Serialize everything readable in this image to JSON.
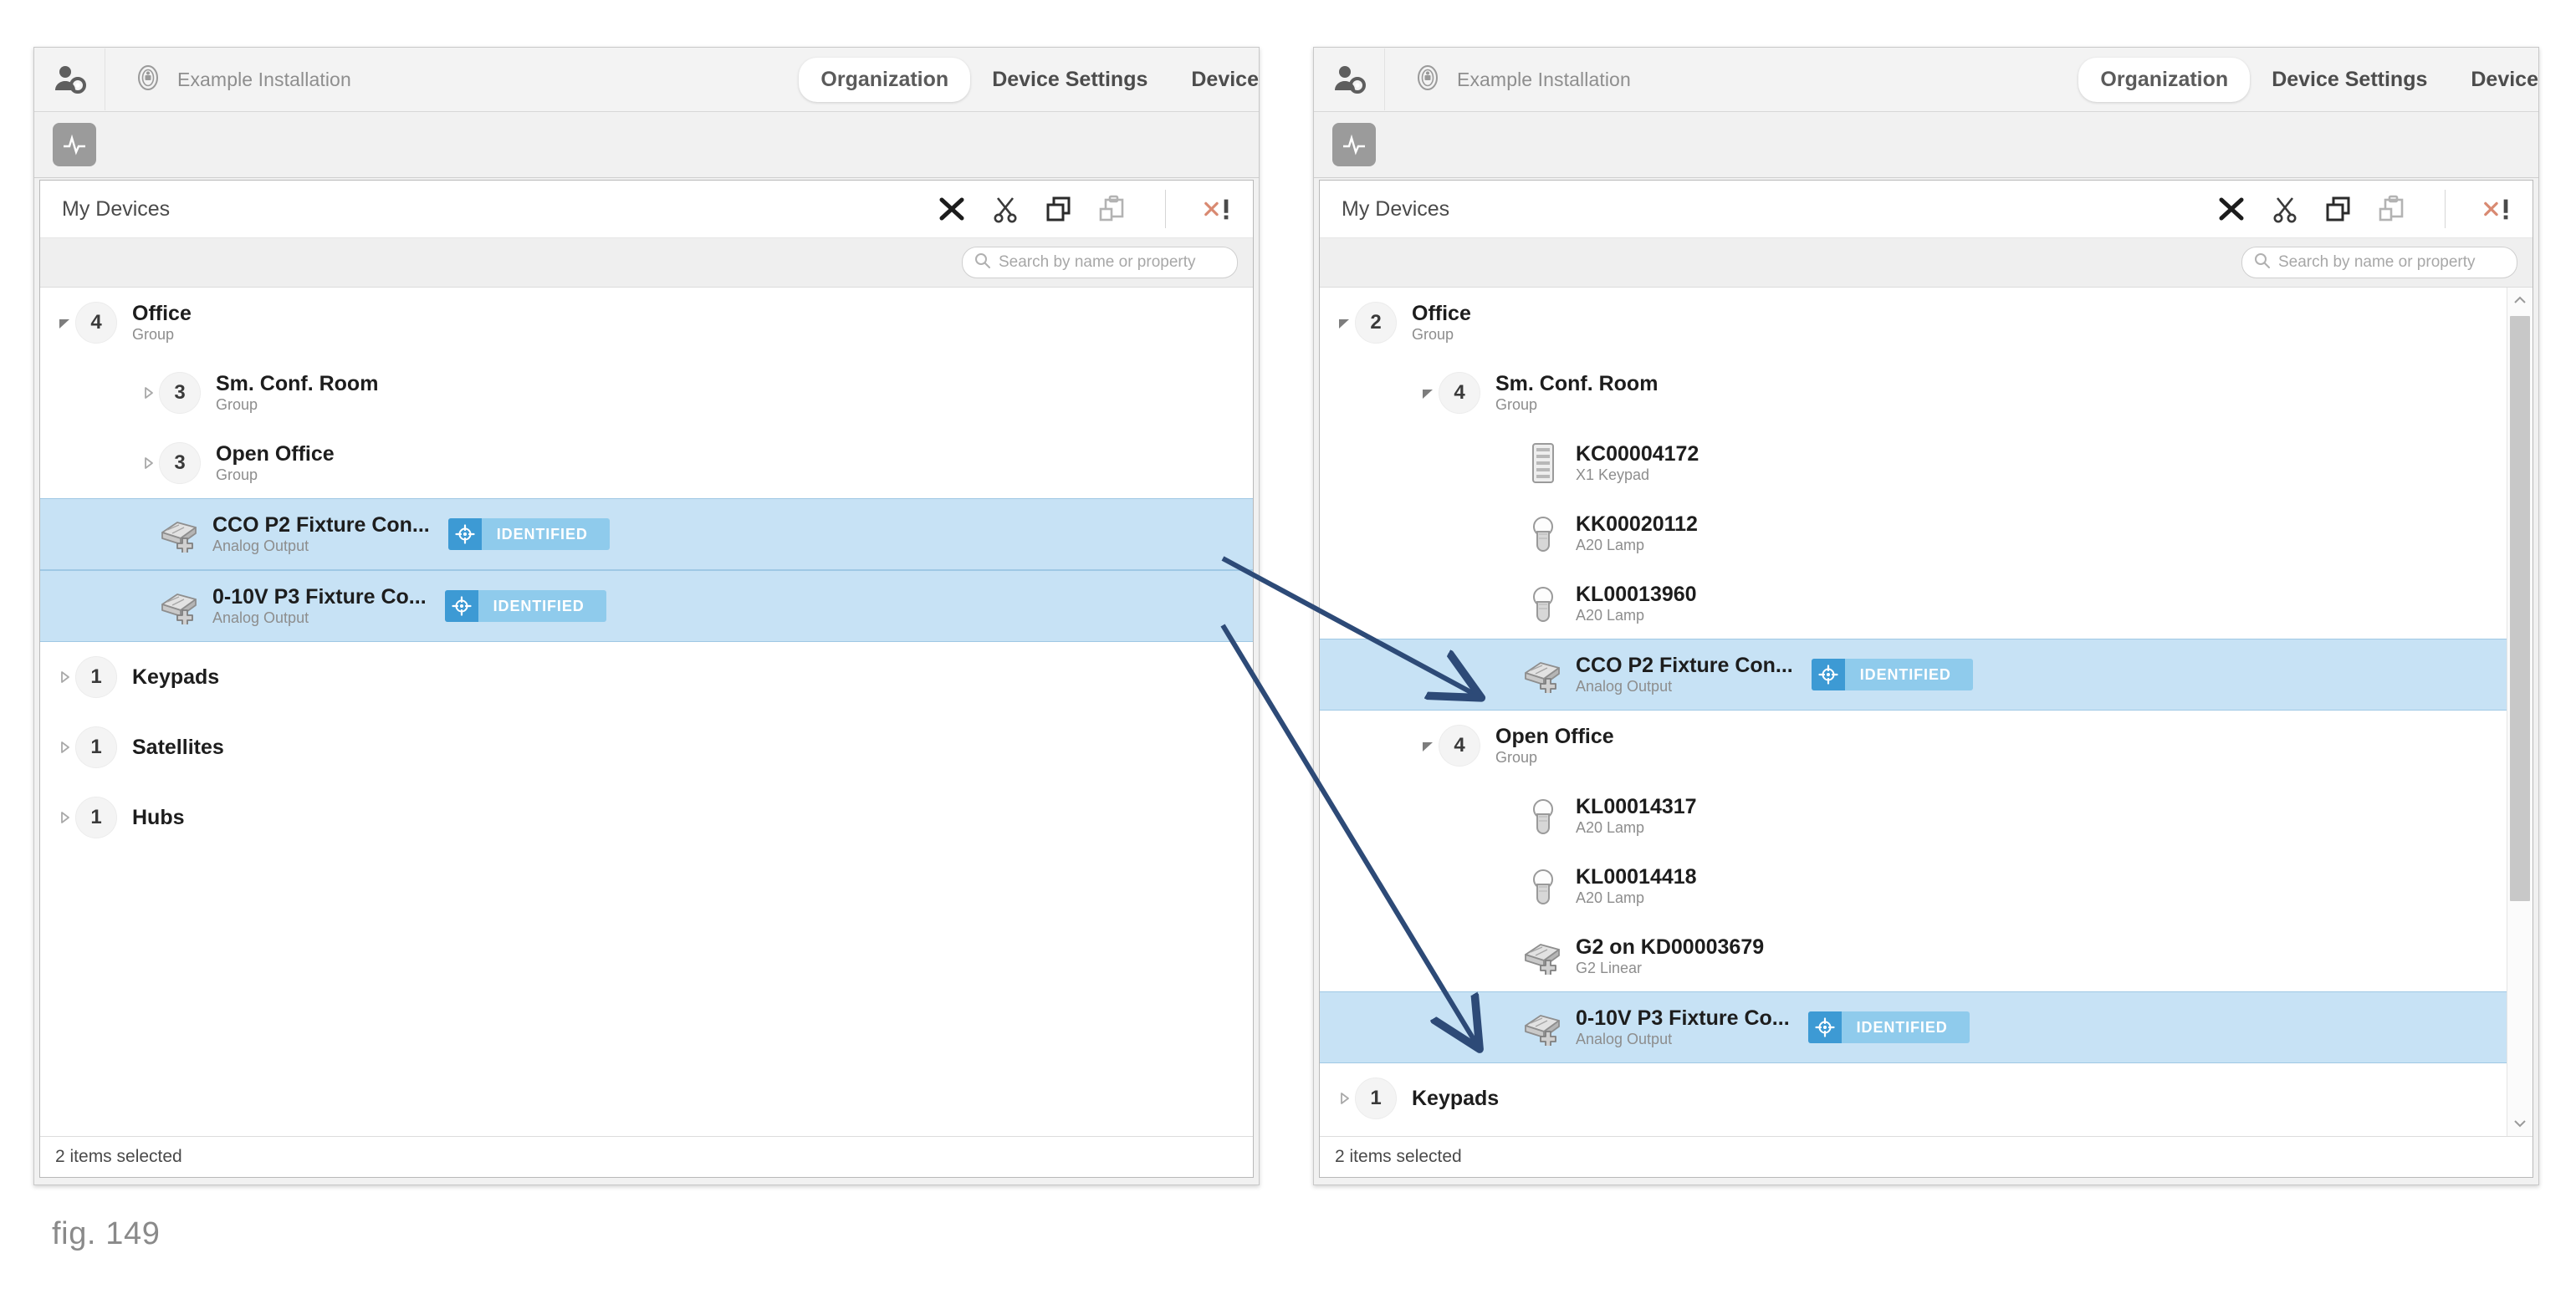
{
  "caption": "fig. 149",
  "appbar": {
    "user_icon": "user-settings-icon",
    "installation_icon": "installation-icon",
    "installation_name": "Example Installation",
    "tabs": [
      {
        "label": "Organization",
        "active": true
      },
      {
        "label": "Device Settings",
        "active": false
      },
      {
        "label": "Device",
        "active": false
      }
    ]
  },
  "substrip": {
    "pulse_icon": "activity-pulse-icon"
  },
  "panel": {
    "title": "My Devices",
    "toolbar": [
      {
        "name": "delete-icon",
        "label": "X"
      },
      {
        "name": "cut-icon",
        "label": "Cut"
      },
      {
        "name": "copy-icon",
        "label": "Copy"
      },
      {
        "name": "paste-icon",
        "label": "Paste"
      },
      {
        "name": "clear-errors-icon",
        "label": "x!"
      }
    ],
    "search": {
      "placeholder": "Search by name or property",
      "value": "",
      "icon": "search-icon"
    },
    "status": "2 items selected"
  },
  "badge": {
    "label": "IDENTIFIED",
    "icon": "target-identify-icon",
    "bg": "#8fcbec",
    "icon_bg": "#3d9ad4"
  },
  "colors": {
    "selection_fill": "#c7e2f5",
    "selection_border": "#9fc8e4",
    "arrow": "#2d4a77",
    "accent_badge": "#3d9ad4"
  },
  "left_tree": [
    {
      "indent": 0,
      "type": "group",
      "twisty": "expanded",
      "count": "4",
      "name": "Office",
      "sub": "Group",
      "selected": false
    },
    {
      "indent": 1,
      "type": "group",
      "twisty": "collapsed",
      "count": "3",
      "name": "Sm. Conf. Room",
      "sub": "Group",
      "selected": false
    },
    {
      "indent": 1,
      "type": "group",
      "twisty": "collapsed",
      "count": "3",
      "name": "Open Office",
      "sub": "Group",
      "selected": false
    },
    {
      "indent": 1,
      "type": "device",
      "icon": "analog-output-icon",
      "name": "CCO P2 Fixture Con...",
      "sub": "Analog Output",
      "selected": true,
      "badge": true
    },
    {
      "indent": 1,
      "type": "device",
      "icon": "analog-output-icon",
      "name": "0-10V P3 Fixture Co...",
      "sub": "Analog Output",
      "selected": true,
      "badge": true
    },
    {
      "indent": 0,
      "type": "group",
      "twisty": "collapsed",
      "count": "1",
      "name": "Keypads",
      "sub": "",
      "selected": false
    },
    {
      "indent": 0,
      "type": "group",
      "twisty": "collapsed",
      "count": "1",
      "name": "Satellites",
      "sub": "",
      "selected": false
    },
    {
      "indent": 0,
      "type": "group",
      "twisty": "collapsed",
      "count": "1",
      "name": "Hubs",
      "sub": "",
      "selected": false
    }
  ],
  "right_tree": [
    {
      "indent": 0,
      "type": "group",
      "twisty": "expanded",
      "count": "2",
      "name": "Office",
      "sub": "Group",
      "selected": false
    },
    {
      "indent": 1,
      "type": "group",
      "twisty": "expanded",
      "count": "4",
      "name": "Sm. Conf. Room",
      "sub": "Group",
      "selected": false
    },
    {
      "indent": 2,
      "type": "device",
      "icon": "keypad-icon",
      "name": "KC00004172",
      "sub": "X1 Keypad",
      "selected": false,
      "badge": false
    },
    {
      "indent": 2,
      "type": "device",
      "icon": "lamp-icon",
      "name": "KK00020112",
      "sub": "A20 Lamp",
      "selected": false,
      "badge": false
    },
    {
      "indent": 2,
      "type": "device",
      "icon": "lamp-icon",
      "name": "KL00013960",
      "sub": "A20 Lamp",
      "selected": false,
      "badge": false
    },
    {
      "indent": 2,
      "type": "device",
      "icon": "analog-output-icon",
      "name": "CCO P2 Fixture Con...",
      "sub": "Analog Output",
      "selected": true,
      "badge": true
    },
    {
      "indent": 1,
      "type": "group",
      "twisty": "expanded",
      "count": "4",
      "name": "Open Office",
      "sub": "Group",
      "selected": false
    },
    {
      "indent": 2,
      "type": "device",
      "icon": "lamp-icon",
      "name": "KL00014317",
      "sub": "A20 Lamp",
      "selected": false,
      "badge": false
    },
    {
      "indent": 2,
      "type": "device",
      "icon": "lamp-icon",
      "name": "KL00014418",
      "sub": "A20 Lamp",
      "selected": false,
      "badge": false
    },
    {
      "indent": 2,
      "type": "device",
      "icon": "analog-output-icon",
      "name": "G2 on KD00003679",
      "sub": "G2 Linear",
      "selected": false,
      "badge": false
    },
    {
      "indent": 2,
      "type": "device",
      "icon": "analog-output-icon",
      "name": "0-10V P3 Fixture Co...",
      "sub": "Analog Output",
      "selected": true,
      "badge": true
    },
    {
      "indent": 0,
      "type": "group",
      "twisty": "collapsed",
      "count": "1",
      "name": "Keypads",
      "sub": "",
      "selected": false
    }
  ]
}
